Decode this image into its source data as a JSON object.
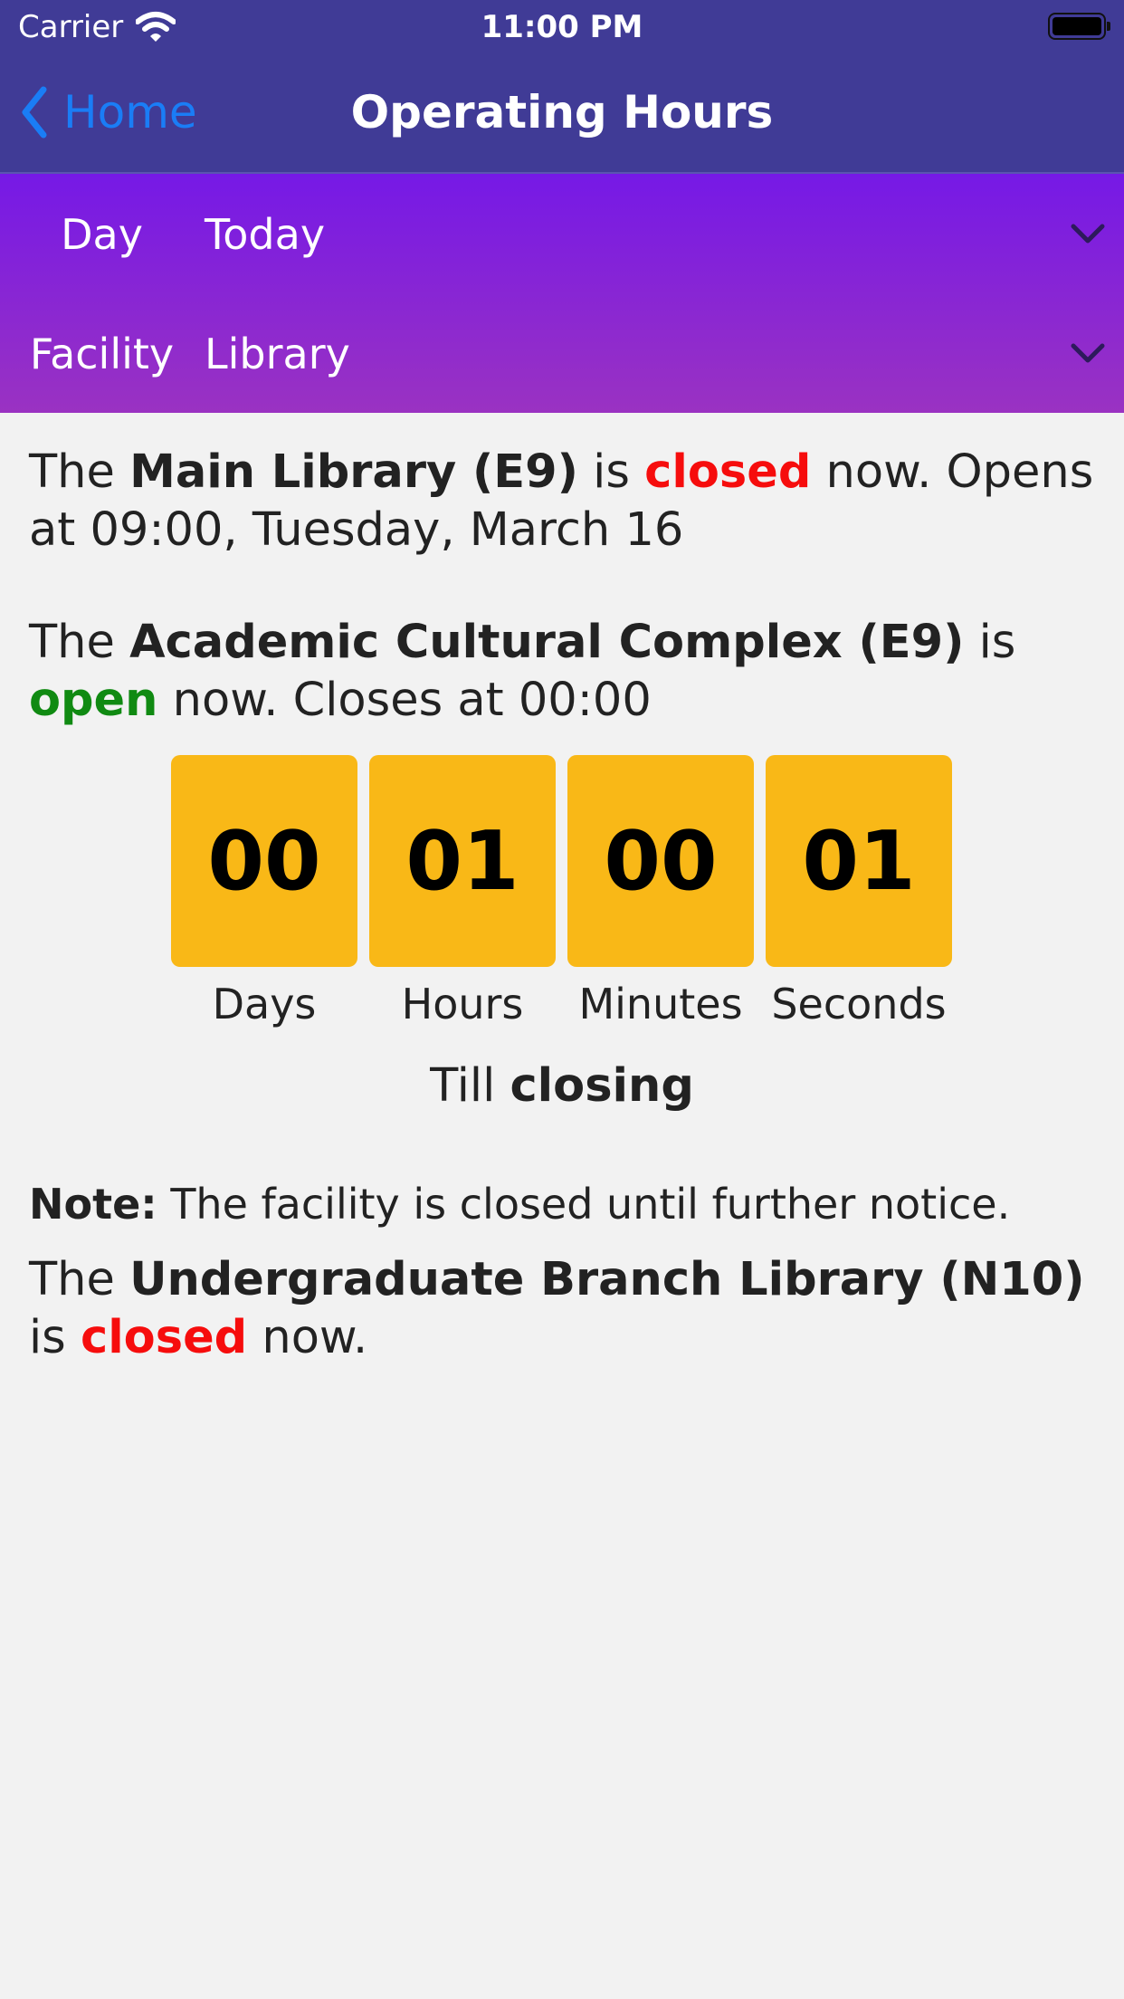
{
  "status_bar": {
    "carrier": "Carrier",
    "time": "11:00 PM"
  },
  "nav": {
    "back_label": "Home",
    "title": "Operating Hours"
  },
  "filters": [
    {
      "label": "Day",
      "value": "Today"
    },
    {
      "label": "Facility",
      "value": "Library"
    }
  ],
  "facilities": {
    "main": {
      "prefix": "The",
      "name": "Main Library (E9)",
      "is": "is",
      "status": "closed",
      "suffix": "now. Opens at 09:00, Tuesday, March 16"
    },
    "acc": {
      "prefix": "The",
      "name": "Academic Cultural Complex (E9)",
      "is": "is",
      "status": "open",
      "suffix": "now. Closes at 00:00"
    },
    "ugb": {
      "prefix": "The",
      "name": "Undergraduate Branch Library (N10)",
      "is": "is",
      "status": "closed",
      "suffix": "now."
    }
  },
  "countdown": {
    "units": [
      {
        "value": "00",
        "label": "Days"
      },
      {
        "value": "01",
        "label": "Hours"
      },
      {
        "value": "00",
        "label": "Minutes"
      },
      {
        "value": "01",
        "label": "Seconds"
      }
    ],
    "till_prefix": "Till",
    "till_word": "closing"
  },
  "note": {
    "label": "Note:",
    "text": "The facility is closed until further notice."
  },
  "colors": {
    "nav_bg": "#403b96",
    "back_link": "#1a7df6",
    "filter_gradient_top": "#7619e6",
    "filter_gradient_bottom": "#9a32c2",
    "closed": "#f60d0d",
    "open": "#108a12",
    "countdown_box": "#f9b817"
  }
}
